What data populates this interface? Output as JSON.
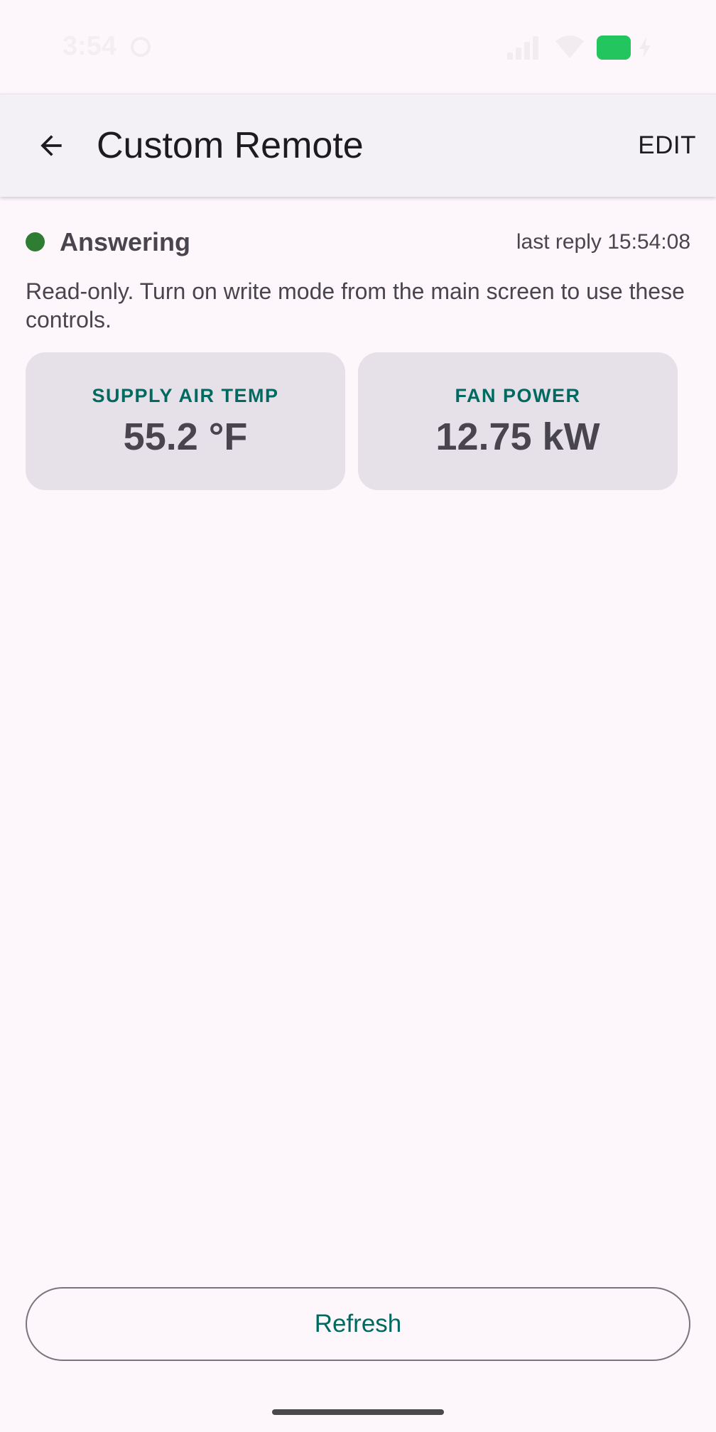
{
  "status_bar": {
    "time": "3:54"
  },
  "app_bar": {
    "title": "Custom Remote",
    "edit_label": "EDIT"
  },
  "connection": {
    "status": "Answering",
    "status_color": "#2e7d32",
    "last_reply": "last reply 15:54:08"
  },
  "notice": "Read-only. Turn on write mode from the main screen to use these controls.",
  "tiles": [
    {
      "label": "SUPPLY AIR TEMP",
      "value": "55.2 °F"
    },
    {
      "label": "FAN POWER",
      "value": "12.75 kW"
    }
  ],
  "footer": {
    "refresh_label": "Refresh"
  },
  "colors": {
    "accent": "#006a60",
    "background": "#fdf7fb",
    "tile_background": "#e6e0e9"
  }
}
